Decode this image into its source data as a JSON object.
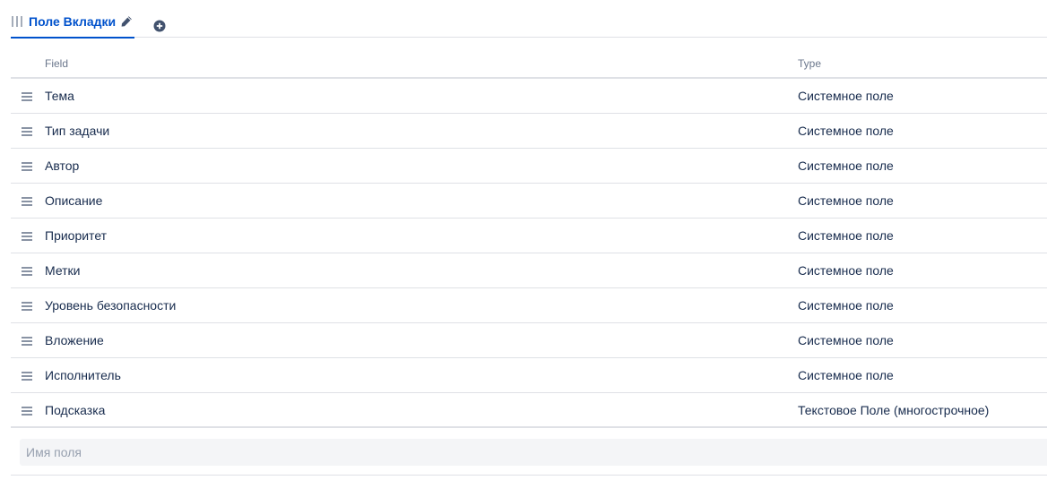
{
  "tab": {
    "label": "Поле Вкладки",
    "grip_icon": "vertical-grip-icon",
    "edit_icon": "pencil-icon",
    "add_icon": "plus-circle-icon"
  },
  "table": {
    "headers": {
      "field": "Field",
      "type": "Type"
    },
    "rows": [
      {
        "field": "Тема",
        "type": "Системное поле"
      },
      {
        "field": "Тип задачи",
        "type": "Системное поле"
      },
      {
        "field": "Автор",
        "type": "Системное поле"
      },
      {
        "field": "Описание",
        "type": "Системное поле"
      },
      {
        "field": "Приоритет",
        "type": "Системное поле"
      },
      {
        "field": "Метки",
        "type": "Системное поле"
      },
      {
        "field": "Уровень безопасности",
        "type": "Системное поле"
      },
      {
        "field": "Вложение",
        "type": "Системное поле"
      },
      {
        "field": "Исполнитель",
        "type": "Системное поле"
      },
      {
        "field": "Подсказка",
        "type": "Текстовое Поле (многострочное)"
      }
    ],
    "drag_icon": "drag-handle-icon"
  },
  "add_field": {
    "placeholder": "Имя поля",
    "value": ""
  },
  "colors": {
    "accent": "#0052cc",
    "text": "#172b4d",
    "muted": "#6b778c",
    "border": "#dfe1e6",
    "input_bg": "#f4f5f7"
  }
}
